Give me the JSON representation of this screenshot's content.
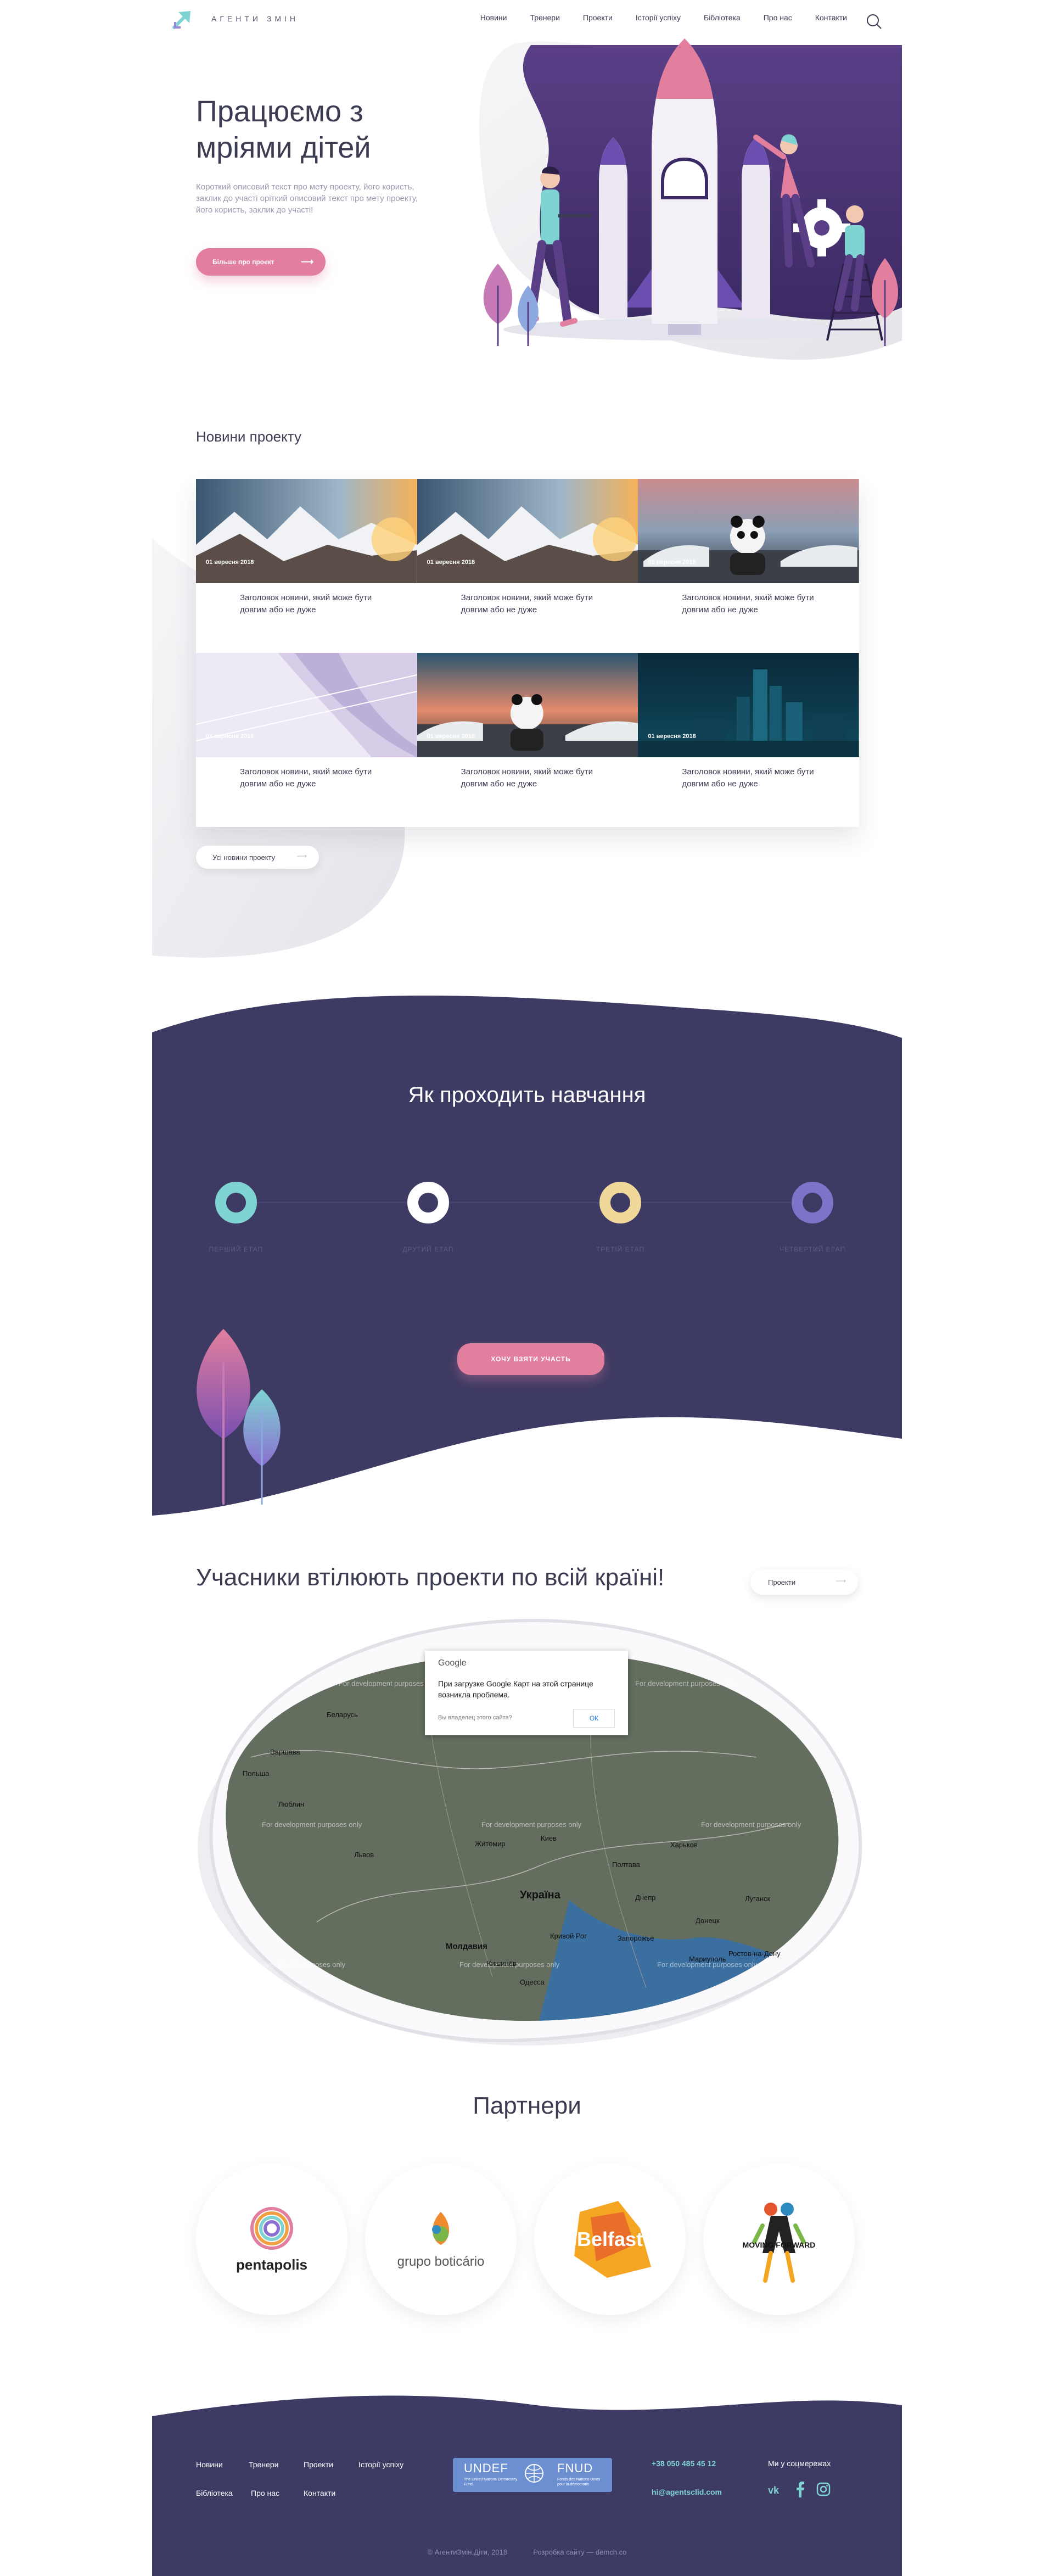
{
  "header": {
    "logo_text": "АГЕНТИ ЗМІН",
    "nav": [
      "Новини",
      "Тренери",
      "Проекти",
      "Історії успіху",
      "Бібліотека",
      "Про нас",
      "Контакти"
    ]
  },
  "hero": {
    "title": "Працюємо з мріями дітей",
    "description": "Короткий описовий текст про мету проекту, його користь, заклик до участі оріткий описовий текст про мету проекту, його користь, заклик до участі!",
    "button": "Більше про проект"
  },
  "news": {
    "heading": "Новини проекту",
    "items": [
      {
        "date": "01 вересня 2018",
        "title": "Заголовок новини, який може бути довгим або не дуже",
        "image": "mountains-sunset"
      },
      {
        "date": "01 вересня 2018",
        "title": "Заголовок новини, який може бути довгим або не дуже",
        "image": "mountains-sunset"
      },
      {
        "date": "01 вересня 2018",
        "title": "Заголовок новини, який може бути довгим або не дуже",
        "image": "panda-cars"
      },
      {
        "date": "01 вересня 2018",
        "title": "Заголовок новини, який може бути довгим або не дуже",
        "image": "abstract-lavender"
      },
      {
        "date": "01 вересня 2018",
        "title": "Заголовок новини, який може бути довгим або не дуже",
        "image": "panda-cars"
      },
      {
        "date": "01 вересня 2018",
        "title": "Заголовок новини, який може бути довгим або не дуже",
        "image": "city-night"
      }
    ],
    "all_button": "Усі новини проекту"
  },
  "learning": {
    "title": "Як проходить навчання",
    "stages": [
      {
        "label": "ПЕРШИЙ ЕТАП",
        "color": "#7fd3d3"
      },
      {
        "label": "ДРУГИЙ ЕТАП",
        "color": "#ffffff"
      },
      {
        "label": "ТРЕТІЙ ЕТАП",
        "color": "#f0d79a"
      },
      {
        "label": "ЧЕТВЕРТИЙ ЕТАП",
        "color": "#7d73c9"
      }
    ],
    "cta": "ХОЧУ ВЗЯТИ УЧАСТЬ"
  },
  "map_section": {
    "heading": "Учасники втілюють проекти по всій країні!",
    "filter_button": "Проекти",
    "dialog": {
      "brand": "Google",
      "message": "При загрузке Google Карт на этой странице возникла проблема.",
      "question": "Вы владелец этого сайта?",
      "ok": "ОК"
    },
    "watermark": "For development purposes only",
    "cities": [
      "Беларусь",
      "Варшава",
      "Польша",
      "Люблин",
      "Львов",
      "Киев",
      "Житомир",
      "Україна",
      "Полтава",
      "Харьков",
      "Днепр",
      "Молдавия",
      "Кривой Рог",
      "Запорожье",
      "Донецк",
      "Мариуполь",
      "Ростов-на-Дону",
      "Луганск",
      "Кишинёв",
      "Одесса"
    ]
  },
  "partners": {
    "heading": "Партнери",
    "items": [
      "pentapolis",
      "grupo boticário",
      "Belfast",
      "MOVING FORWARD"
    ]
  },
  "footer": {
    "nav_row1": [
      "Новини",
      "Тренери",
      "Проекти",
      "Історії успіху"
    ],
    "nav_row2": [
      "Бібліотека",
      "Про нас",
      "Контакти"
    ],
    "fund_left": "UNDEF",
    "fund_right": "FNUD",
    "fund_sub_left": "The United Nations Democracy Fund",
    "fund_sub_right": "Fonds des Nations Unies pour la démocratie",
    "phone": "+38 050 485 45 12",
    "email": "hi@agentsclid.com",
    "social_label": "Ми у соцмережах",
    "social": [
      "vk-icon",
      "facebook-icon",
      "instagram-icon"
    ],
    "copyright": "© АгентиЗмін.Діти, 2018",
    "developer": "Розробка сайту — demch.co"
  }
}
